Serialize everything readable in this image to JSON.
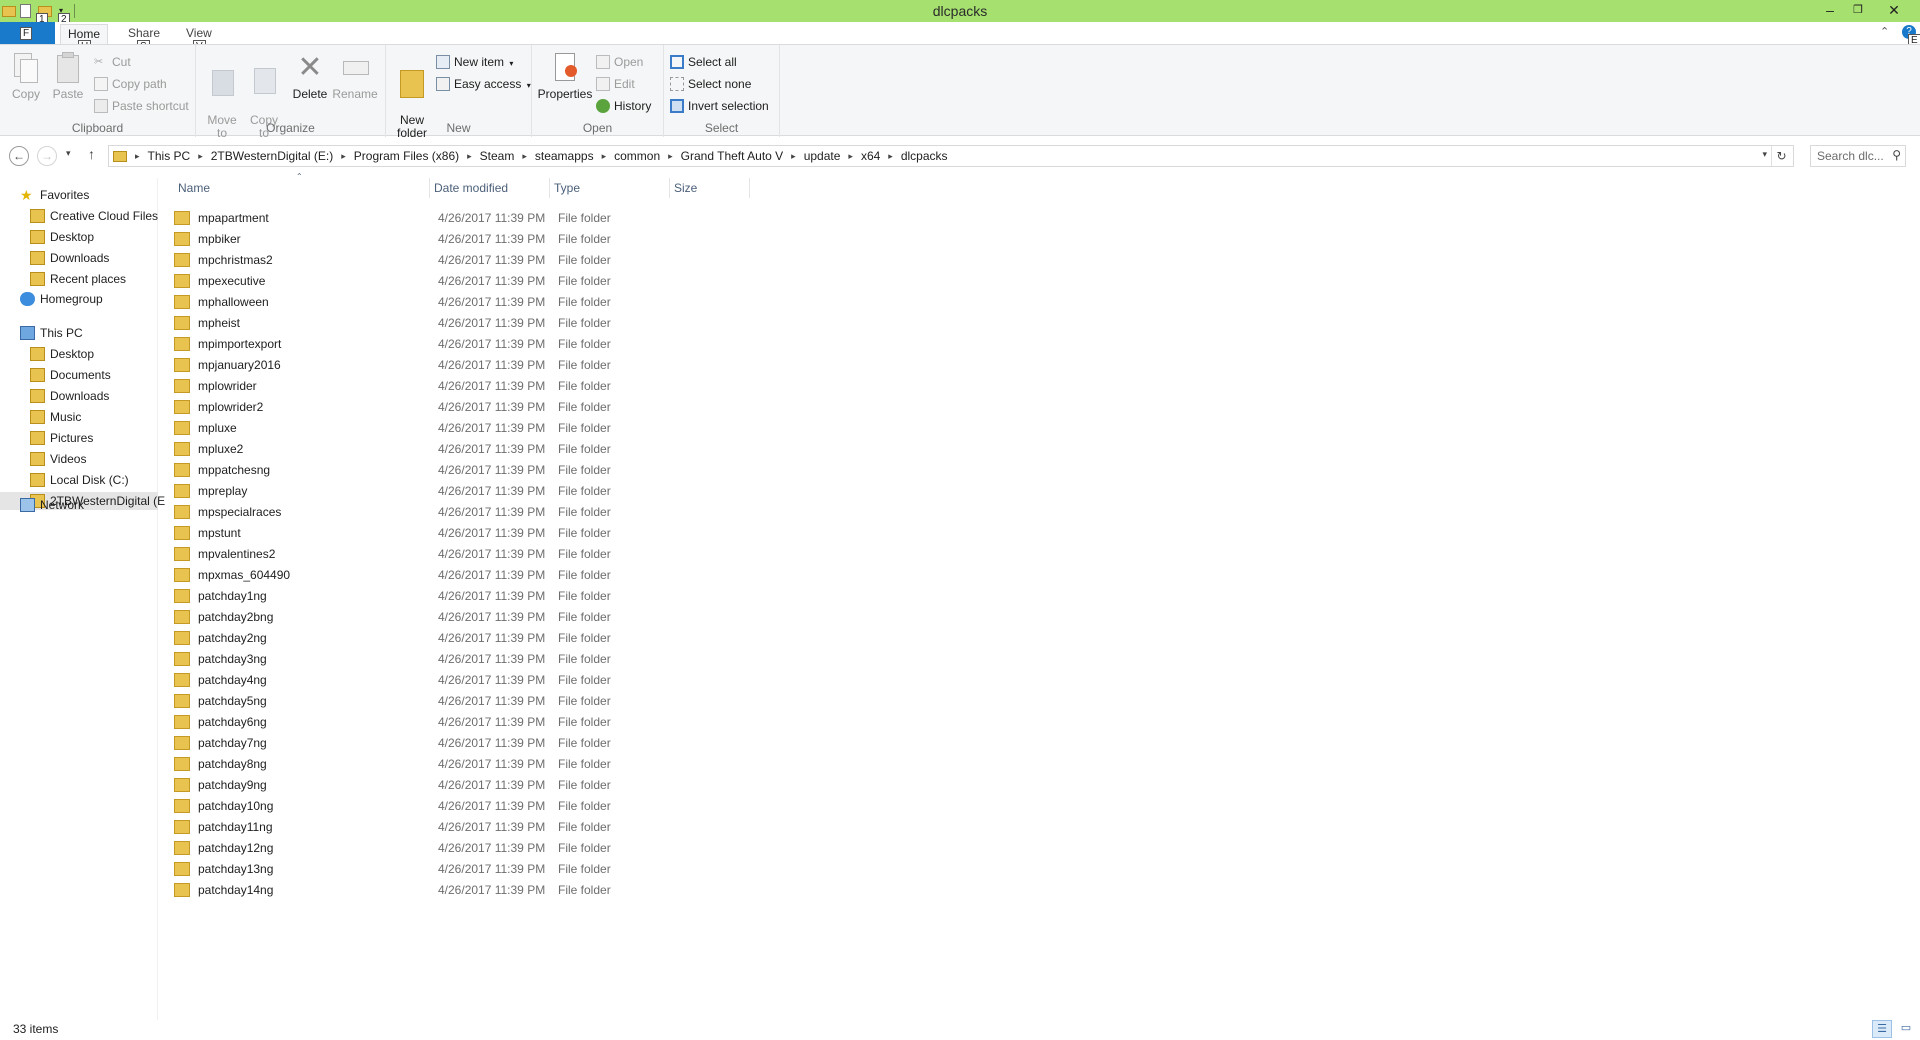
{
  "window": {
    "title": "dlcpacks",
    "minimize": "–",
    "restore": "❐",
    "close": "✕"
  },
  "keytips": {
    "qat1": "1",
    "qat2": "2",
    "file": "F",
    "home": "H",
    "share": "S",
    "view": "V",
    "help": "E"
  },
  "tabs": {
    "home": "Home",
    "share": "Share",
    "view": "View"
  },
  "ribbon": {
    "clipboard": {
      "label": "Clipboard",
      "copy": "Copy",
      "paste": "Paste",
      "cut": "Cut",
      "copy_path": "Copy path",
      "paste_shortcut": "Paste shortcut"
    },
    "organize": {
      "label": "Organize",
      "move_to": "Move\nto",
      "copy_to": "Copy\nto",
      "delete": "Delete",
      "rename": "Rename"
    },
    "new": {
      "label": "New",
      "new_folder": "New\nfolder",
      "new_item": "New item",
      "easy_access": "Easy access"
    },
    "open": {
      "label": "Open",
      "properties": "Properties",
      "open": "Open",
      "edit": "Edit",
      "history": "History"
    },
    "select": {
      "label": "Select",
      "select_all": "Select all",
      "select_none": "Select none",
      "invert_selection": "Invert selection"
    }
  },
  "address": {
    "crumbs": [
      "This PC",
      "2TBWesternDigital (E:)",
      "Program Files (x86)",
      "Steam",
      "steamapps",
      "common",
      "Grand Theft Auto V",
      "update",
      "x64",
      "dlcpacks"
    ],
    "search_placeholder": "Search dlc..."
  },
  "nav": {
    "favorites": "Favorites",
    "favorites_items": [
      "Creative Cloud Files",
      "Desktop",
      "Downloads",
      "Recent places"
    ],
    "homegroup": "Homegroup",
    "this_pc": "This PC",
    "this_pc_items": [
      "Desktop",
      "Documents",
      "Downloads",
      "Music",
      "Pictures",
      "Videos",
      "Local Disk (C:)",
      "2TBWesternDigital (E"
    ],
    "network": "Network"
  },
  "columns": {
    "name": "Name",
    "date": "Date modified",
    "type": "Type",
    "size": "Size"
  },
  "files": {
    "common_date": "4/26/2017 11:39 PM",
    "common_type": "File folder",
    "names": [
      "mpapartment",
      "mpbiker",
      "mpchristmas2",
      "mpexecutive",
      "mphalloween",
      "mpheist",
      "mpimportexport",
      "mpjanuary2016",
      "mplowrider",
      "mplowrider2",
      "mpluxe",
      "mpluxe2",
      "mppatchesng",
      "mpreplay",
      "mpspecialraces",
      "mpstunt",
      "mpvalentines2",
      "mpxmas_604490",
      "patchday1ng",
      "patchday2bng",
      "patchday2ng",
      "patchday3ng",
      "patchday4ng",
      "patchday5ng",
      "patchday6ng",
      "patchday7ng",
      "patchday8ng",
      "patchday9ng",
      "patchday10ng",
      "patchday11ng",
      "patchday12ng",
      "patchday13ng",
      "patchday14ng"
    ]
  },
  "status": {
    "item_count": "33 items"
  },
  "colors": {
    "titlebar": "#a6e06f",
    "file_tab": "#1979ca",
    "folder": "#e8c34f",
    "header_text": "#4c607a"
  }
}
